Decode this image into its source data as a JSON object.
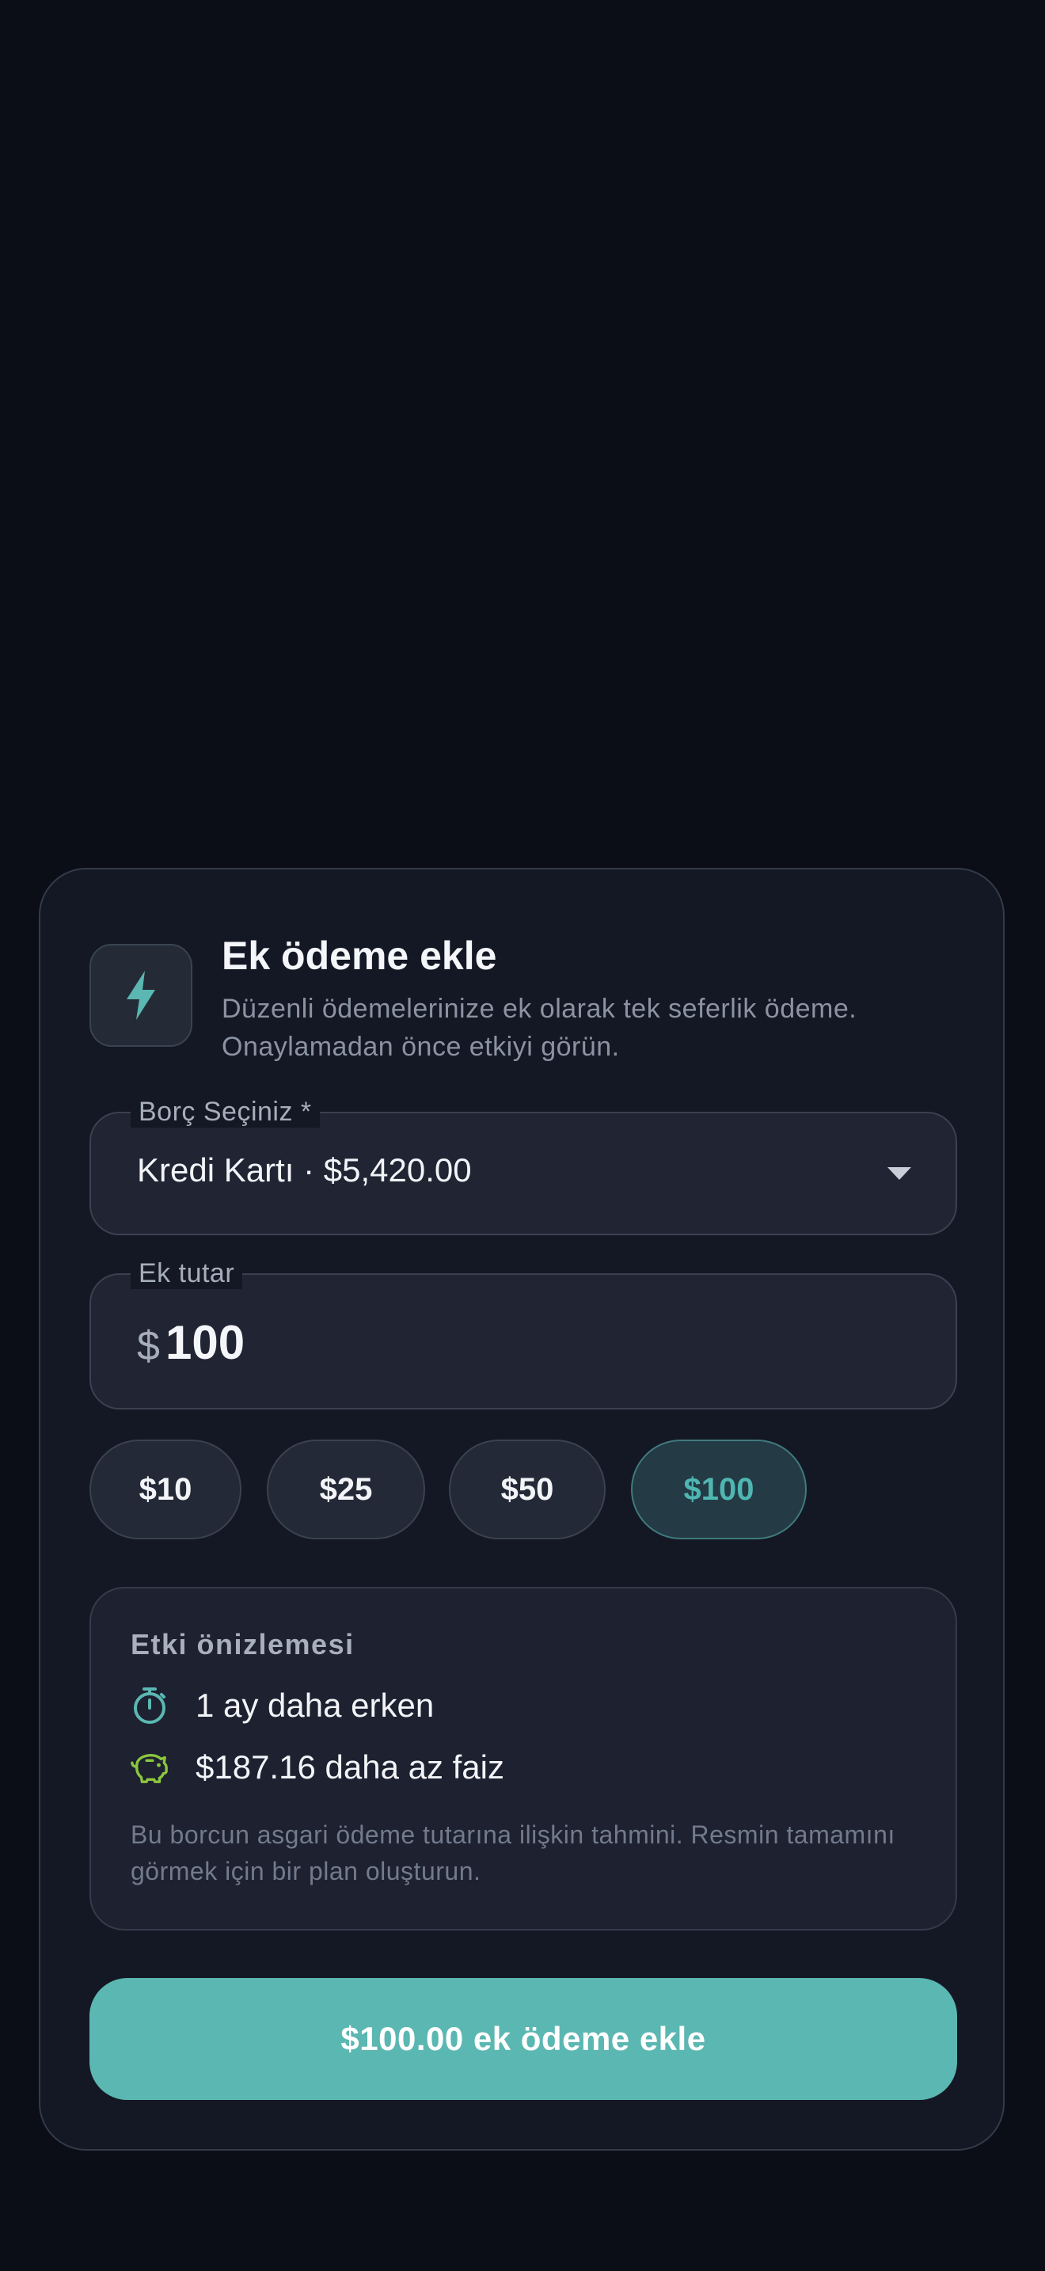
{
  "header": {
    "icon": "lightning-bolt-icon",
    "title": "Ek ödeme ekle",
    "subtitle": "Düzenli ödemelerinize ek olarak tek seferlik ödeme. Onaylamadan önce etkiyi görün."
  },
  "debt_select": {
    "label": "Borç Seçiniz *",
    "value": "Kredi Kartı · $5,420.00",
    "icon": "caret-down-icon"
  },
  "amount": {
    "label": "Ek tutar",
    "currency": "$",
    "value": "100"
  },
  "quick_amounts": [
    {
      "label": "$10",
      "selected": false
    },
    {
      "label": "$25",
      "selected": false
    },
    {
      "label": "$50",
      "selected": false
    },
    {
      "label": "$100",
      "selected": true
    }
  ],
  "impact": {
    "title": "Etki önizlemesi",
    "rows": [
      {
        "icon": "stopwatch-icon",
        "text": "1 ay daha erken"
      },
      {
        "icon": "piggy-bank-icon",
        "text": "$187.16 daha az faiz"
      }
    ],
    "note": "Bu borcun asgari ödeme tutarına ilişkin tahmini. Resmin tamamını görmek için bir plan oluşturun."
  },
  "submit": {
    "label": "$100.00 ek ödeme ekle"
  },
  "colors": {
    "background": "#0b0e17",
    "card": "#141824",
    "accent": "#5bb7b2",
    "accent_text": "#4fb6b2",
    "piggy_icon": "#8cc63f"
  }
}
